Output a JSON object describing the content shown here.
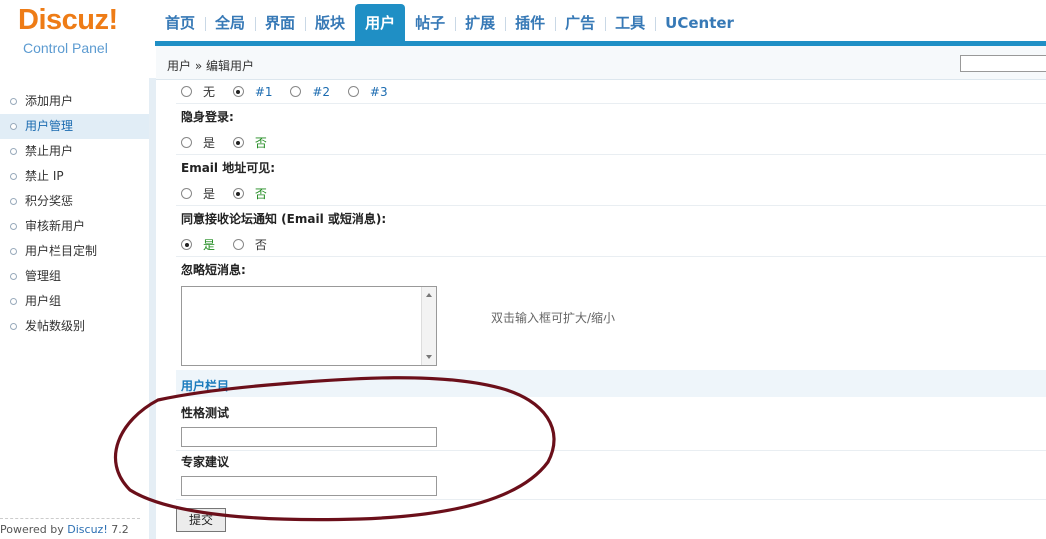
{
  "logo": {
    "brand": "Discuz!",
    "subtitle": "Control Panel"
  },
  "nav": {
    "items": [
      "首页",
      "全局",
      "界面",
      "版块",
      "用户",
      "帖子",
      "扩展",
      "插件",
      "广告",
      "工具",
      "UCenter"
    ],
    "active": "用户"
  },
  "sidebar": {
    "items": [
      "添加用户",
      "用户管理",
      "禁止用户",
      "禁止 IP",
      "积分奖惩",
      "审核新用户",
      "用户栏目定制",
      "管理组",
      "用户组",
      "发帖数级别"
    ],
    "active": "用户管理"
  },
  "footer": {
    "powered_prefix": "Powered by ",
    "powered_brand": "Discuz!",
    "powered_version": " 7.2"
  },
  "breadcrumb": "用户 » 编辑用户",
  "form": {
    "partial_row": {
      "opt1": "无",
      "opt2": "#1",
      "opt3": "#2",
      "opt4": "#3",
      "selected": "#1"
    },
    "invisible_login": {
      "label": "隐身登录:",
      "yes": "是",
      "no": "否",
      "selected": "否"
    },
    "email_visible": {
      "label": "Email 地址可见:",
      "yes": "是",
      "no": "否",
      "selected": "否"
    },
    "accept_notice": {
      "label": "同意接收论坛通知 (Email 或短消息):",
      "yes": "是",
      "no": "否",
      "selected": "是"
    },
    "ignore_pm": {
      "label": "忽略短消息:",
      "value": "",
      "hint": "双击输入框可扩大/缩小"
    },
    "section_title": "用户栏目",
    "personality_test": {
      "label": "性格测试",
      "value": ""
    },
    "expert_advice": {
      "label": "专家建议",
      "value": ""
    },
    "submit_label": "提交"
  },
  "colors": {
    "accent": "#1f8fc5",
    "brand_orange": "#ee7c16",
    "annotation": "#6b0f1a",
    "selected_option": "#1e8a1e"
  }
}
